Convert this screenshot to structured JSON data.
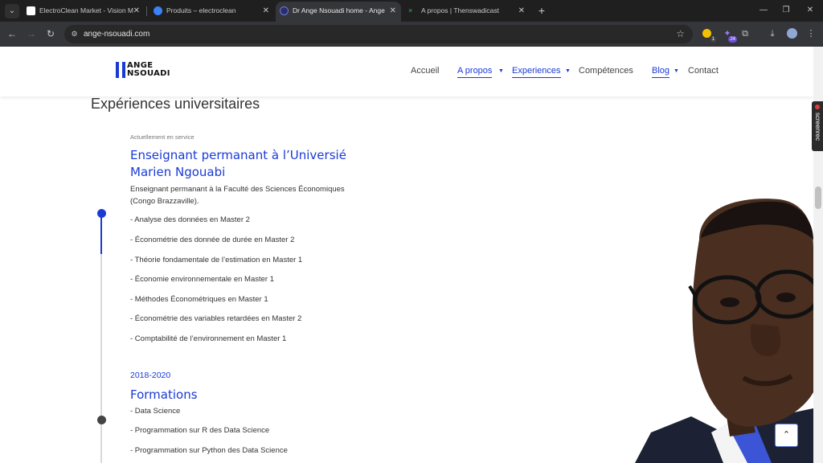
{
  "browser": {
    "tabs": [
      {
        "title": "ElectroClean Market - Vision M",
        "active": false
      },
      {
        "title": "Produits – electroclean",
        "active": false
      },
      {
        "title": "Dr Ange Nsouadi home - Ange",
        "active": true
      },
      {
        "title": "A propos | Thenswadicast",
        "active": false
      }
    ],
    "url": "ange-nsouadi.com",
    "extension_badge": "24",
    "extension_badge_small": "1"
  },
  "site": {
    "logo_line1": "ANGE",
    "logo_line2": "NSOUADI",
    "menu": [
      {
        "label": "Accueil",
        "active": false,
        "dropdown": false
      },
      {
        "label": "A propos",
        "active": true,
        "dropdown": true
      },
      {
        "label": "Experiences",
        "active": true,
        "dropdown": true
      },
      {
        "label": "Compétences",
        "active": false,
        "dropdown": false
      },
      {
        "label": "Blog",
        "active": true,
        "dropdown": true
      },
      {
        "label": "Contact",
        "active": false,
        "dropdown": false
      }
    ]
  },
  "content": {
    "section_title": "Expériences universitaires",
    "job": {
      "status": "Actuellement en service",
      "title": "Enseignant permanant à l’Universié Marien Ngouabi",
      "description": "Enseignant permanant à la Faculté des Sciences Économiques (Congo Brazzaville).",
      "courses": [
        "- Analyse des données en Master 2",
        "- Économétrie des donnée de durée en Master 2",
        "- Théorie fondamentale de l’estimation en Master 1",
        "- Économie environnementale en Master 1",
        "- Méthodes Économétriques en Master 1",
        "- Économétrie des variables retardées en Master 2",
        "- Comptabilité de l’environnement en Master 1"
      ]
    },
    "formation": {
      "period": "2018-2020",
      "title": "Formations",
      "items": [
        "- Data Science",
        "- Programmation sur R des Data Science",
        "- Programmation sur Python des Data Science"
      ]
    }
  },
  "widgets": {
    "screenrec_label": "screenrec"
  },
  "colors": {
    "accent": "#1a3ad6",
    "chrome_dark": "#1f1f1f",
    "chrome_toolbar": "#35363a"
  }
}
